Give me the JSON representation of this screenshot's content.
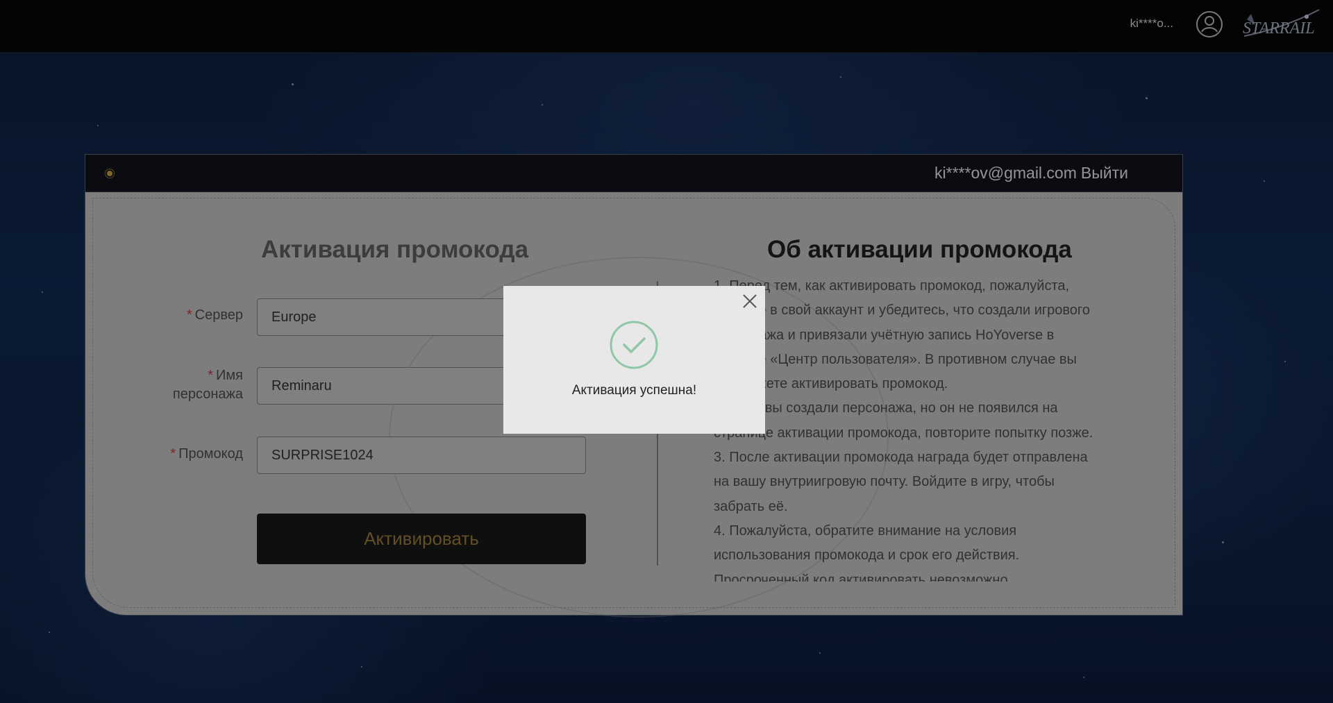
{
  "topbar": {
    "user_masked": "ki****o...",
    "avatar_icon": "user-circle-icon",
    "logo_icon": "star-rail-logo"
  },
  "header": {
    "account_email": "ki****ov@gmail.com",
    "logout_label": "Выйти",
    "accent_color": "#c9a24a"
  },
  "form": {
    "title": "Активация промокода",
    "required_mark": "*",
    "server_label": "Сервер",
    "server_value": "Europe",
    "character_label_line1": "Имя",
    "character_label_line2": "персонажа",
    "character_value": "Reminaru",
    "code_label": "Промокод",
    "code_value": "SURPRISE1024",
    "submit_label": "Активировать"
  },
  "info": {
    "title": "Об активации промокода",
    "lines": [
      "1. Перед тем, как активировать промокод, пожалуйста,",
      "войдите в свой аккаунт и убедитесь, что создали игрового",
      "персонажа и привязали учётную запись HoYoverse в",
      "разделе «Центр пользователя». В противном случае вы",
      "не сможете активировать промокод.",
      "2. Если вы создали персонажа, но он не появился на",
      "странице активации промокода, повторите попытку позже.",
      "3. После активации промокода награда будет отправлена",
      "на вашу внутриигровую почту. Войдите в игру, чтобы",
      "забрать её.",
      "4. Пожалуйста, обратите внимание на условия",
      "использования промокода и срок его действия.",
      "Просроченный код активировать невозможно."
    ]
  },
  "modal": {
    "message": "Активация успешна!",
    "success_color": "#8fc7a8",
    "close_icon": "close-icon",
    "status_icon": "check-circle-icon"
  }
}
